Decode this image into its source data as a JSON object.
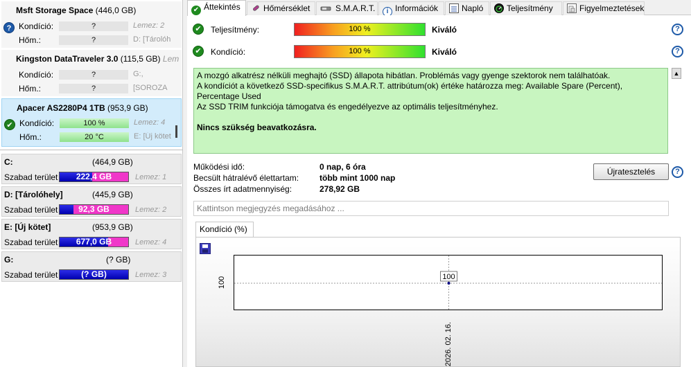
{
  "left": {
    "disks": [
      {
        "name": "Msft    Storage Space",
        "size": "(446,0 GB)",
        "status": "?",
        "kondicio_label": "Kondíció:",
        "kondicio_value": "?",
        "kondicio_extra": "Lemez: 2",
        "hom_label": "Hőm.:",
        "hom_value": "?",
        "hom_extra": "D: [Tárolóh"
      },
      {
        "name": "Kingston DataTraveler 3.0",
        "size": "(115,5 GB)",
        "extra_name": "Lem",
        "kondicio_label": "Kondíció:",
        "kondicio_value": "?",
        "kondicio_extra": "G:,",
        "hom_label": "Hőm.:",
        "hom_value": "?",
        "hom_extra": "[SOROZA"
      },
      {
        "name": "Apacer AS2280P4 1TB",
        "size": "(953,9 GB)",
        "status": "✔",
        "kondicio_label": "Kondíció:",
        "kondicio_value": "100 %",
        "kondicio_extra": "Lemez: 4",
        "hom_label": "Hőm.:",
        "hom_value": "20 °C",
        "hom_extra": "E: [Új kötet"
      }
    ],
    "volumes": [
      {
        "name": "C:",
        "size": "(464,9 GB)",
        "free_label": "Szabad terület",
        "free": "222,4 GB",
        "free_fraction": 0.478,
        "disk": "Lemez: 1"
      },
      {
        "name": "D: [Tárolóhely]",
        "size": "(445,9 GB)",
        "free_label": "Szabad terület",
        "free": "92,3 GB",
        "free_fraction": 0.207,
        "disk": "Lemez: 2"
      },
      {
        "name": "E: [Új kötet]",
        "size": "(953,9 GB)",
        "free_label": "Szabad terület",
        "free": "677,0 GB",
        "free_fraction": 0.71,
        "disk": "Lemez: 4"
      },
      {
        "name": "G:",
        "size": "(? GB)",
        "free_label": "Szabad terület",
        "free": "(? GB)",
        "free_fraction": 1.0,
        "disk": "Lemez: 3"
      }
    ]
  },
  "tabs": [
    {
      "label": "Áttekintés",
      "icon": "check-icon"
    },
    {
      "label": "Hőmérséklet",
      "icon": "thermometer-icon"
    },
    {
      "label": "S.M.A.R.T.",
      "icon": "smart-icon"
    },
    {
      "label": "Információk",
      "icon": "info-icon"
    },
    {
      "label": "Napló",
      "icon": "log-icon"
    },
    {
      "label": "Teljesítmény",
      "icon": "speed-icon"
    },
    {
      "label": "Figyelmeztetések",
      "icon": "alert-icon"
    }
  ],
  "overview": {
    "performance_label": "Teljesítmény:",
    "performance_bar": "100 %",
    "performance_value": "Kiváló",
    "condition_label": "Kondíció:",
    "condition_bar": "100 %",
    "condition_value": "Kiváló",
    "status_lines": [
      "A mozgó alkatrész nélküli meghajtó (SSD) állapota hibátlan. Problémás vagy gyenge szektorok nem találhatóak.",
      "A kondíciót a következő SSD-specifikus S.M.A.R.T. attribútum(ok) értéke határozza meg:  Available Spare (Percent), Percentage Used",
      "Az SSD TRIM funkciója támogatva és engedélyezve az optimális teljesítményhez."
    ],
    "status_action": "Nincs szükség beavatkozásra.",
    "uptime_label": "Működési idő:",
    "uptime_value": "0 nap, 6 óra",
    "lifetime_label": "Becsült hátralévő élettartam:",
    "lifetime_value": "több mint 1000 nap",
    "written_label": "Összes írt adatmennyiség:",
    "written_value": "278,92 GB",
    "retest_label": "Újratesztelés",
    "note_placeholder": "Kattintson megjegyzés megadásához ..."
  },
  "chart_tab": "Kondíció  (%)",
  "chart_data": {
    "type": "line",
    "x": [
      "2026. 02. 16."
    ],
    "series": [
      {
        "values": [
          100
        ]
      }
    ],
    "ylabel": "",
    "ytick_labels": [
      "100"
    ],
    "data_labels": [
      "100"
    ],
    "grid": true
  },
  "colors": {
    "accent": "#1e5aa8",
    "ok": "#208020",
    "status_bg": "#c8f5c0",
    "volume_used": "#f037c9",
    "volume_free": "#1010d0"
  }
}
